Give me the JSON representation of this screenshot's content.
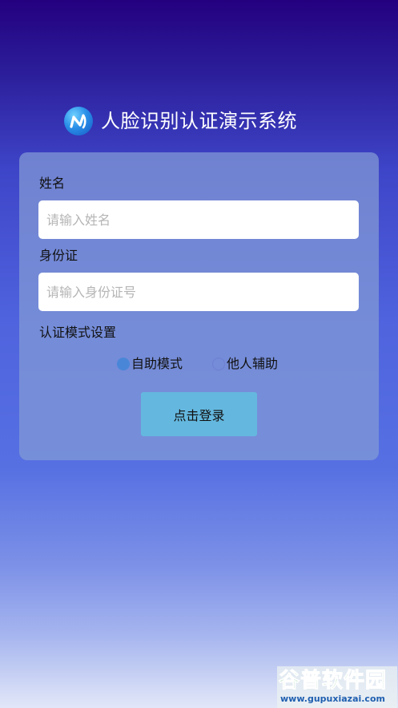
{
  "header": {
    "logo_icon": "face-recognition-logo-icon",
    "title": "人脸识别认证演示系统"
  },
  "form": {
    "name_label": "姓名",
    "name_placeholder": "请输入姓名",
    "name_value": "",
    "id_label": "身份证",
    "id_placeholder": "请输入身份证号",
    "id_value": "",
    "mode_label": "认证模式设置",
    "modes": [
      {
        "label": "自助模式",
        "selected": true
      },
      {
        "label": "他人辅助",
        "selected": false
      }
    ],
    "login_label": "点击登录"
  },
  "watermark": {
    "name": "谷普软件园",
    "url": "www.gupuxiazai.com"
  },
  "colors": {
    "card": "#849bd6",
    "login_button": "#64b8df",
    "radio_selected": "#4a86d8",
    "watermark_green": "#35a852"
  }
}
